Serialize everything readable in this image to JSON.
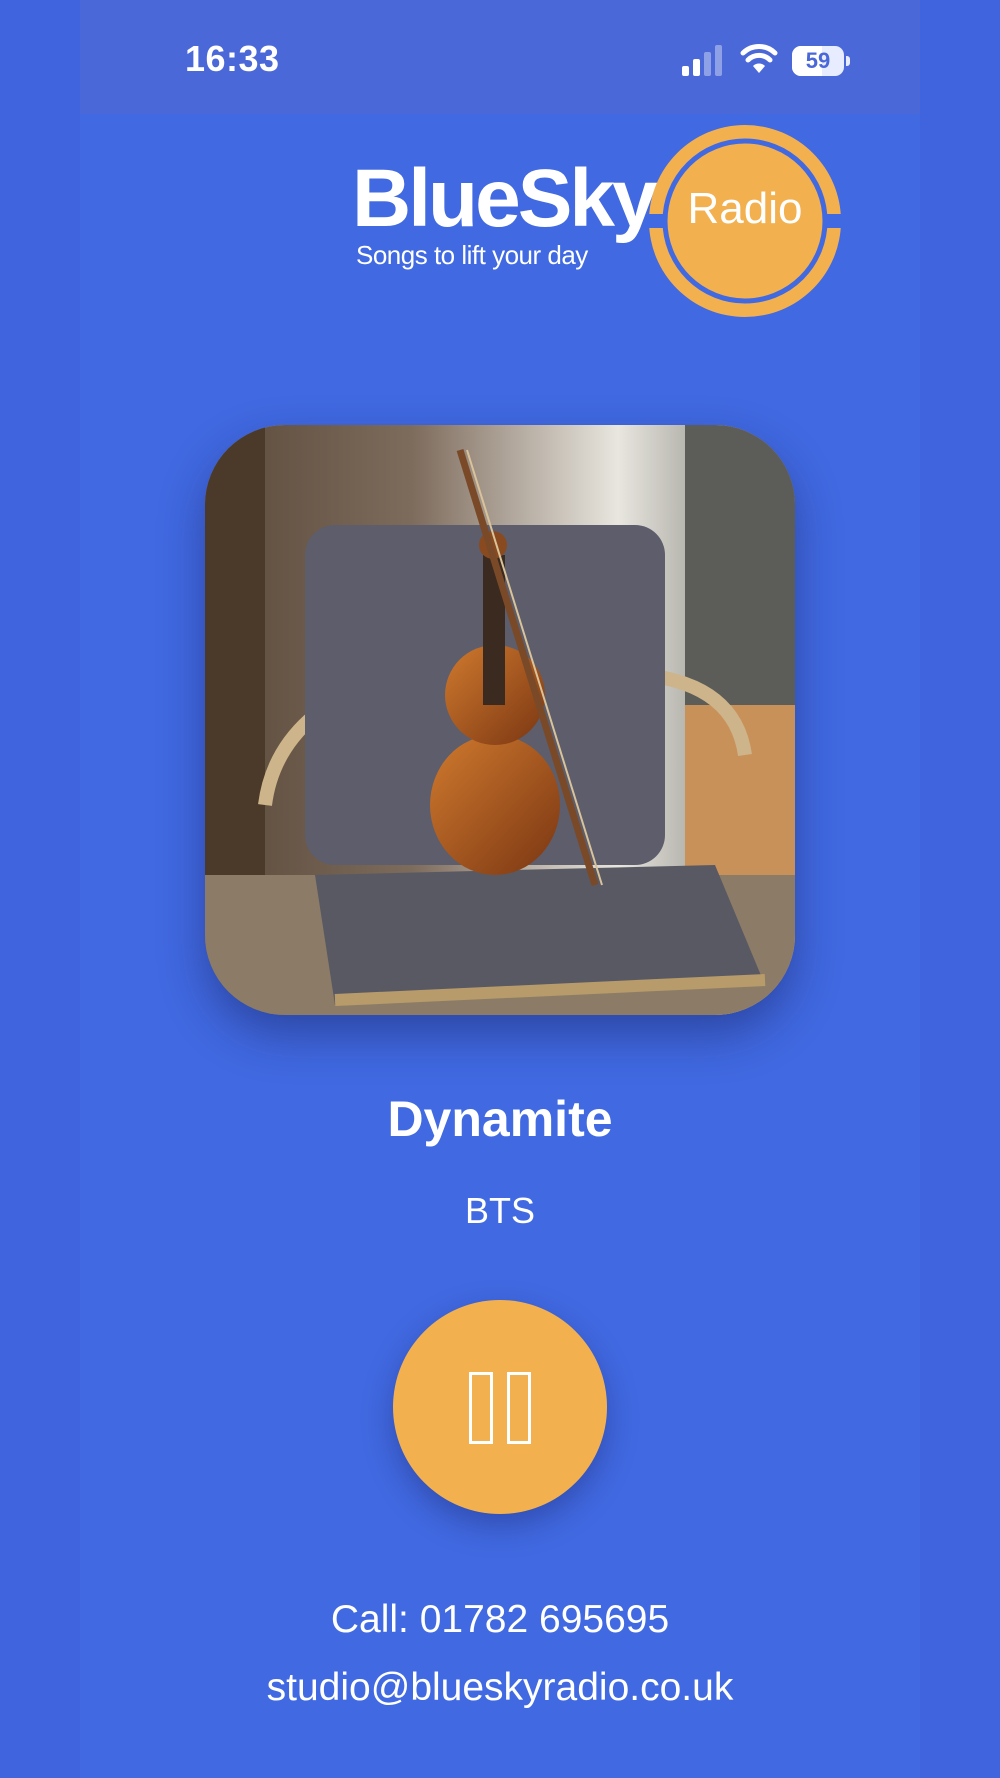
{
  "status_bar": {
    "time": "16:33",
    "battery": "59"
  },
  "logo": {
    "brand": "BlueSky",
    "tagline": "Songs to lift your day",
    "badge": "Radio"
  },
  "now_playing": {
    "title": "Dynamite",
    "artist": "BTS"
  },
  "player": {
    "state": "playing",
    "button_icon": "pause-icon"
  },
  "contact": {
    "phone": "Call: 01782 695695",
    "email": "studio@blueskyradio.co.uk"
  },
  "colors": {
    "background": "#4169e1",
    "status_bar": "#4b68d8",
    "accent": "#f3b04f",
    "text": "#ffffff"
  }
}
